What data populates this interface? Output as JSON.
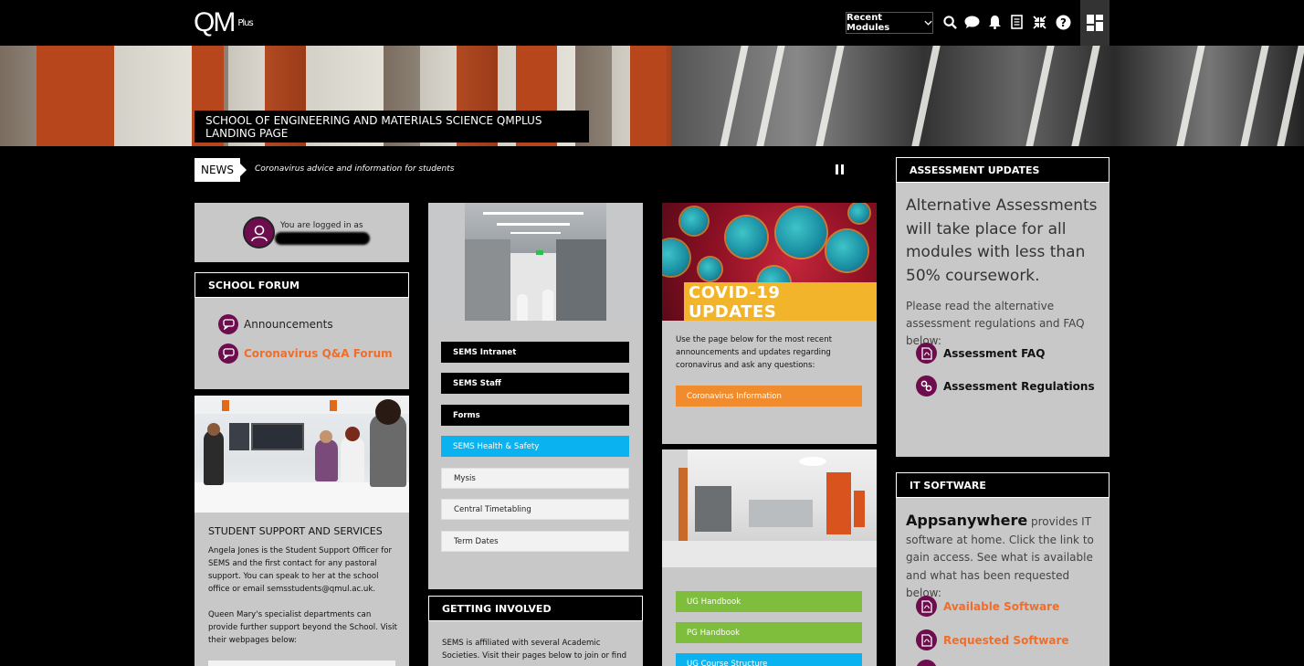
{
  "topbar": {
    "logo_main": "QM",
    "logo_stack": [
      "Plus"
    ],
    "recent_modules": "Recent Modules",
    "icons": [
      "search-icon",
      "chat-icon",
      "bell-icon",
      "notes-icon",
      "compress-icon",
      "help-icon",
      "dashboard-icon"
    ]
  },
  "banner": {
    "title": "SCHOOL OF ENGINEERING AND MATERIALS SCIENCE QMPLUS LANDING PAGE"
  },
  "news": {
    "label": "NEWS",
    "text": "Coronavirus advice and information for students"
  },
  "login": {
    "label": "You are logged in as"
  },
  "school_forum": {
    "header": "SCHOOL FORUM",
    "items": [
      {
        "label": "Announcements",
        "color": "#222222"
      },
      {
        "label": "Coronavirus Q&A Forum",
        "color": "#f06d2a"
      }
    ]
  },
  "support": {
    "title": "STUDENT SUPPORT AND SERVICES",
    "body": "Angela Jones is the Student Support Officer for SEMS and the first contact for any pastoral support. You can speak to her at the school office or email semsstudents@qmul.ac.uk.",
    "body2": "Queen Mary's specialist departments can provide further support beyond the School. Visit their webpages below:"
  },
  "links": {
    "buttons": [
      {
        "label": "SEMS Intranet",
        "style": "black"
      },
      {
        "label": "SEMS Staff",
        "style": "black"
      },
      {
        "label": "Forms",
        "style": "black"
      },
      {
        "label": "SEMS Health & Safety",
        "style": "blue"
      },
      {
        "label": "Mysis",
        "style": "white"
      },
      {
        "label": "Central Timetabling",
        "style": "white"
      },
      {
        "label": "Term Dates",
        "style": "white"
      }
    ]
  },
  "getting_involved": {
    "header": "GETTING INVOLVED",
    "body": "SEMS is affiliated with several Academic Societies. Visit their pages below to join or find"
  },
  "covid": {
    "image_title": "COVID-19 UPDATES",
    "body": "Use the page below for the most recent announcements and updates regarding coronavirus and ask any questions:",
    "button": "Coronavirus Information"
  },
  "handbooks": {
    "buttons": [
      "UG Handbook",
      "PG Handbook",
      "UG Course Structure"
    ]
  },
  "assessment": {
    "header": "ASSESSMENT UPDATES",
    "big": "Alternative Assessments will take place for all modules with less than 50% coursework.",
    "sub": "Please read the alternative assessment regulations and FAQ below:",
    "items": [
      "Assessment FAQ",
      "Assessment Regulations"
    ]
  },
  "it_software": {
    "header": "IT SOFTWARE",
    "lead": "Appsanywhere",
    "text": " provides IT software at home. Click the link to gain access. See what is available and what has been requested below:",
    "items": [
      "Available Software",
      "Requested Software"
    ]
  },
  "colors": {
    "accent_orange": "#f06d2a",
    "purple": "#6e0d4d",
    "blue": "#0ab3ef",
    "green": "#7fbd3d"
  }
}
